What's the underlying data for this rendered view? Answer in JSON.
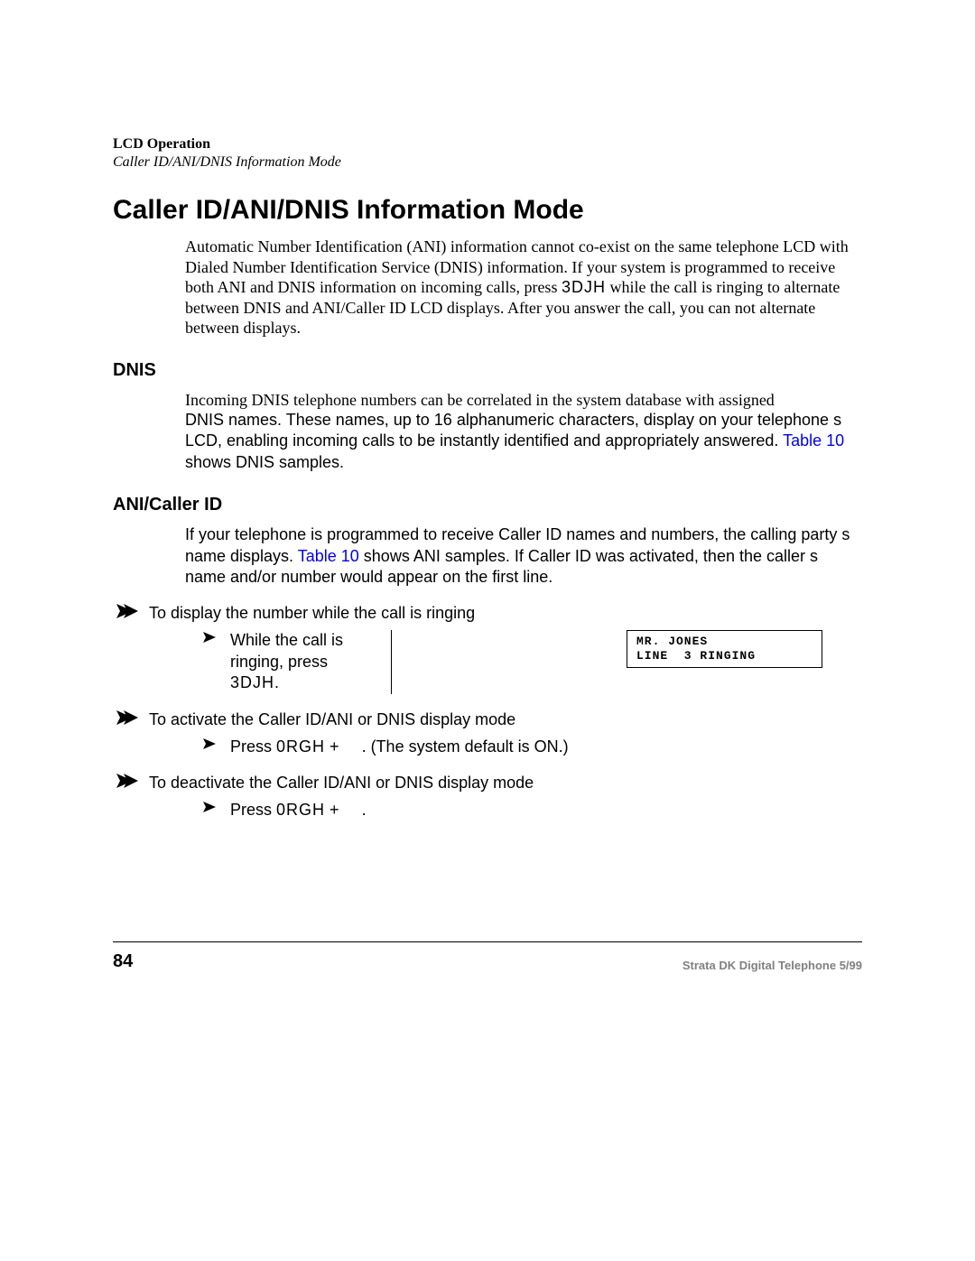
{
  "header": {
    "bold": "LCD Operation",
    "italic": "Caller ID/ANI/DNIS Information Mode"
  },
  "title": "Caller ID/ANI/DNIS Information Mode",
  "intro": {
    "p1a": "Automatic Number Identification (ANI) information cannot co-exist on the same telephone LCD with Dialed Number Identification Service (DNIS) information. If your system is programmed to receive both ANI and DNIS information on incoming calls, press ",
    "p1_key": "3DJH",
    "p1b": " while the call is ringing to alternate between DNIS and ANI/Caller ID LCD displays. After you answer the call, you can not alternate between displays."
  },
  "dnis": {
    "heading": "DNIS",
    "p_serif": "Incoming DNIS telephone numbers can be correlated in the system database with assigned ",
    "p_sans_a": "DNIS names. These names, up to 16 alphanumeric characters, display on your telephone s LCD, enabling incoming calls to be instantly identified and appropriately answered. ",
    "link1": "Table 10",
    "p_sans_b": " shows DNIS samples."
  },
  "ani": {
    "heading": "ANI/Caller ID",
    "p_a": "If your telephone is programmed to receive Caller ID names and numbers, the calling party s name displays. ",
    "link1": "Table 10",
    "p_b": " shows ANI samples. If Caller ID was activated, then the caller s name and/or number would appear on the first line."
  },
  "steps": {
    "s1": "To display the number while the call is ringing",
    "s1_sub_a": "While the call is ringing, press ",
    "s1_sub_key": "3DJH",
    "s1_sub_b": ".",
    "s2": "To activate the Caller ID/ANI or DNIS display mode",
    "s2_sub_a": "Press ",
    "s2_sub_key": "0RGH",
    "s2_sub_b": " + ",
    "s2_sub_c": ". (The system default is ON.)",
    "s3": "To deactivate the Caller ID/ANI or DNIS display mode",
    "s3_sub_a": "Press ",
    "s3_sub_key": "0RGH",
    "s3_sub_b": " + ",
    "s3_sub_c": "."
  },
  "lcd": {
    "line1": "MR. JONES",
    "line2": "LINE  3 RINGING"
  },
  "footer": {
    "page": "84",
    "doc": "Strata DK Digital Telephone   5/99"
  }
}
